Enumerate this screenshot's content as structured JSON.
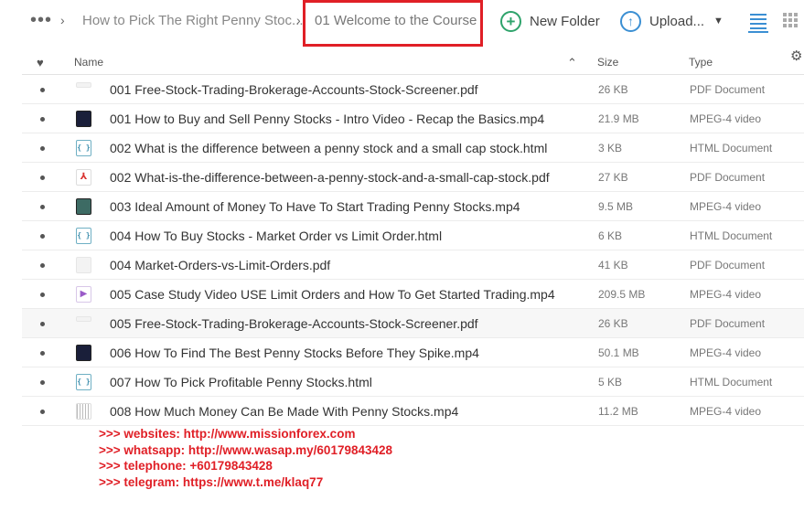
{
  "breadcrumb": {
    "more": "•••",
    "separator": "›",
    "parent": "How to Pick The Right Penny Stoc...",
    "current": "01 Welcome to the Course"
  },
  "toolbar": {
    "new_folder_label": "New Folder",
    "upload_label": "Upload...",
    "new_folder_icon": "+",
    "upload_icon": "↑"
  },
  "columns": {
    "favorite_icon": "♥",
    "name": "Name",
    "sort_icon": "⌃",
    "size": "Size",
    "type": "Type",
    "settings_icon": "⚙"
  },
  "files": [
    {
      "icon": "pdf-blank-thin",
      "name": "001 Free-Stock-Trading-Brokerage-Accounts-Stock-Screener.pdf",
      "size": "26 KB",
      "type": "PDF Document"
    },
    {
      "icon": "video-dark",
      "name": "001 How to Buy and Sell Penny Stocks - Intro Video - Recap the Basics.mp4",
      "size": "21.9 MB",
      "type": "MPEG-4 video"
    },
    {
      "icon": "html",
      "name": "002 What is the difference between a penny stock and a small cap stock.html",
      "size": "3 KB",
      "type": "HTML Document"
    },
    {
      "icon": "pdf",
      "name": "002 What-is-the-difference-between-a-penny-stock-and-a-small-cap-stock.pdf",
      "size": "27 KB",
      "type": "PDF Document"
    },
    {
      "icon": "video-teal",
      "name": "003 Ideal Amount of Money To Have To Start Trading Penny Stocks.mp4",
      "size": "9.5 MB",
      "type": "MPEG-4 video"
    },
    {
      "icon": "html",
      "name": "004 How To Buy Stocks - Market Order vs Limit Order.html",
      "size": "6 KB",
      "type": "HTML Document"
    },
    {
      "icon": "pdf-blank",
      "name": "004 Market-Orders-vs-Limit-Orders.pdf",
      "size": "41 KB",
      "type": "PDF Document"
    },
    {
      "icon": "video-purple",
      "name": "005 Case Study Video USE Limit Orders and How To Get Started Trading.mp4",
      "size": "209.5 MB",
      "type": "MPEG-4 video"
    },
    {
      "icon": "pdf-blank-thin",
      "name": "005 Free-Stock-Trading-Brokerage-Accounts-Stock-Screener.pdf",
      "size": "26 KB",
      "type": "PDF Document"
    },
    {
      "icon": "video-dark",
      "name": "006 How To Find The Best Penny Stocks Before They Spike.mp4",
      "size": "50.1 MB",
      "type": "MPEG-4 video"
    },
    {
      "icon": "html",
      "name": "007 How To Pick Profitable Penny Stocks.html",
      "size": "5 KB",
      "type": "HTML Document"
    },
    {
      "icon": "stripes",
      "name": "008 How Much Money Can Be Made With Penny Stocks.mp4",
      "size": "11.2 MB",
      "type": "MPEG-4 video"
    }
  ],
  "overlay_text": [
    ">>> websites: http://www.missionforex.com",
    ">>> whatsapp: http://www.wasap.my/60179843428",
    ">>> telephone: +60179843428",
    ">>> telegram: https://www.t.me/klaq77"
  ],
  "colors": {
    "highlight_box": "#e01f26",
    "new_folder": "#2ea36b",
    "accent": "#3b8fd3",
    "overlay_text": "#e01f26"
  }
}
